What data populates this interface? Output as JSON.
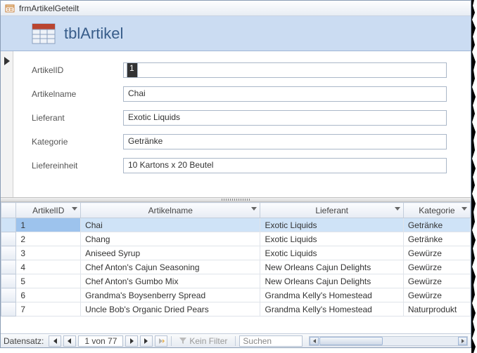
{
  "window": {
    "title": "frmArtikelGeteilt"
  },
  "header": {
    "title": "tblArtikel"
  },
  "form": {
    "fields": [
      {
        "label": "ArtikelID",
        "value": "1",
        "selected": true
      },
      {
        "label": "Artikelname",
        "value": "Chai"
      },
      {
        "label": "Lieferant",
        "value": "Exotic Liquids"
      },
      {
        "label": "Kategorie",
        "value": "Getränke"
      },
      {
        "label": "Liefereinheit",
        "value": "10 Kartons x 20 Beutel"
      }
    ]
  },
  "grid": {
    "columns": [
      "ArtikelID",
      "Artikelname",
      "Lieferant",
      "Kategorie"
    ],
    "rows": [
      {
        "id": "1",
        "name": "Chai",
        "supplier": "Exotic Liquids",
        "category": "Getränke",
        "selected": true
      },
      {
        "id": "2",
        "name": "Chang",
        "supplier": "Exotic Liquids",
        "category": "Getränke"
      },
      {
        "id": "3",
        "name": "Aniseed Syrup",
        "supplier": "Exotic Liquids",
        "category": "Gewürze"
      },
      {
        "id": "4",
        "name": "Chef Anton's Cajun Seasoning",
        "supplier": "New Orleans Cajun Delights",
        "category": "Gewürze"
      },
      {
        "id": "5",
        "name": "Chef Anton's Gumbo Mix",
        "supplier": "New Orleans Cajun Delights",
        "category": "Gewürze"
      },
      {
        "id": "6",
        "name": "Grandma's Boysenberry Spread",
        "supplier": "Grandma Kelly's Homestead",
        "category": "Gewürze"
      },
      {
        "id": "7",
        "name": "Uncle Bob's Organic Dried Pears",
        "supplier": "Grandma Kelly's Homestead",
        "category": "Naturprodukt"
      }
    ]
  },
  "nav": {
    "label": "Datensatz:",
    "position": "1 von 77",
    "filter_label": "Kein Filter",
    "search_placeholder": "Suchen"
  }
}
